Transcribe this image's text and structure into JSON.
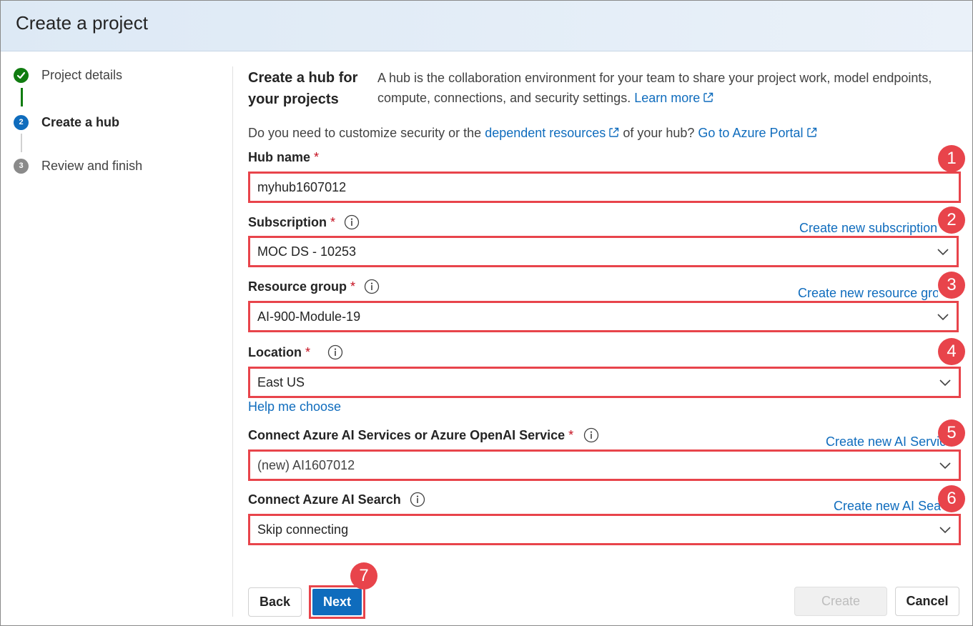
{
  "header": {
    "title": "Create a project"
  },
  "stepper": {
    "steps": [
      {
        "label": "Project details",
        "state": "done",
        "number": ""
      },
      {
        "label": "Create a hub",
        "state": "active",
        "number": "2"
      },
      {
        "label": "Review and finish",
        "state": "todo",
        "number": "3"
      }
    ]
  },
  "intro": {
    "title": "Create a hub for your projects",
    "text": "A hub is the collaboration environment for your team to share your project work, model endpoints, compute, connections, and security settings.",
    "learn_more": "Learn more"
  },
  "customize": {
    "prefix": "Do you need to customize security or the",
    "dependent_link": "dependent resources",
    "middle": "of your hub?",
    "portal_link": "Go to Azure Portal"
  },
  "fields": {
    "hub_name": {
      "label": "Hub name",
      "required": "*",
      "value": "myhub1607012",
      "badge": "1"
    },
    "subscription": {
      "label": "Subscription",
      "required": "*",
      "value": "MOC DS - 10253",
      "create_link": "Create new subscription",
      "badge": "2"
    },
    "resource_group": {
      "label": "Resource group",
      "required": "*",
      "value": "AI-900-Module-19",
      "create_link": "Create new resource group",
      "badge": "3"
    },
    "location": {
      "label": "Location",
      "required": "*",
      "value": "East US",
      "help_link": "Help me choose",
      "badge": "4"
    },
    "ai_services": {
      "label": "Connect Azure AI Services or Azure OpenAI Service",
      "required": "*",
      "value": "(new) AI1607012",
      "create_link": "Create new AI Services",
      "badge": "5"
    },
    "ai_search": {
      "label": "Connect Azure AI Search",
      "value": "Skip connecting",
      "create_link": "Create new AI Search",
      "badge": "6"
    }
  },
  "footer": {
    "back": "Back",
    "next": "Next",
    "next_badge": "7",
    "create": "Create",
    "cancel": "Cancel"
  },
  "colors": {
    "accent": "#0f6cbd",
    "highlight": "#e8444b",
    "done": "#107c10",
    "required": "#c50f1f"
  }
}
